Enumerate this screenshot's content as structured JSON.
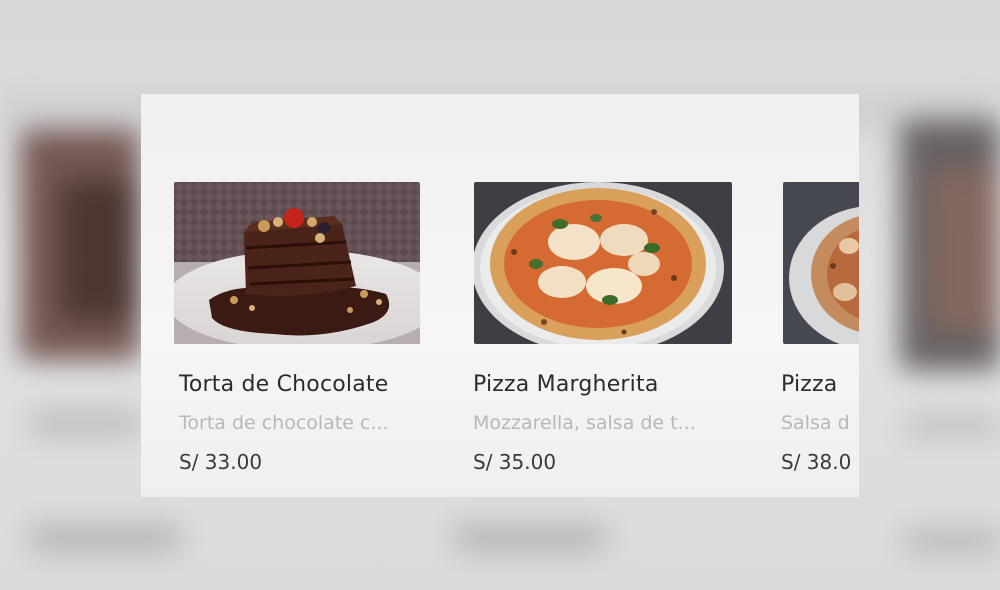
{
  "products": [
    {
      "name": "Torta de Chocolate",
      "description": "Torta de chocolate c...",
      "price": "S/ 33.00",
      "image_icon": "chocolate-cake-photo"
    },
    {
      "name": "Pizza Margherita",
      "description": "Mozzarella, salsa de t...",
      "price": "S/ 35.00",
      "image_icon": "pizza-photo"
    },
    {
      "name": "Pizza",
      "description": "Salsa d",
      "price": "S/ 38.0",
      "image_icon": "pizza-photo"
    }
  ],
  "colors": {
    "name_text": "#2c2c2c",
    "description_text": "#b8b8b8",
    "price_text": "#3a3a3a",
    "panel_bg": "#f4f4f4"
  }
}
